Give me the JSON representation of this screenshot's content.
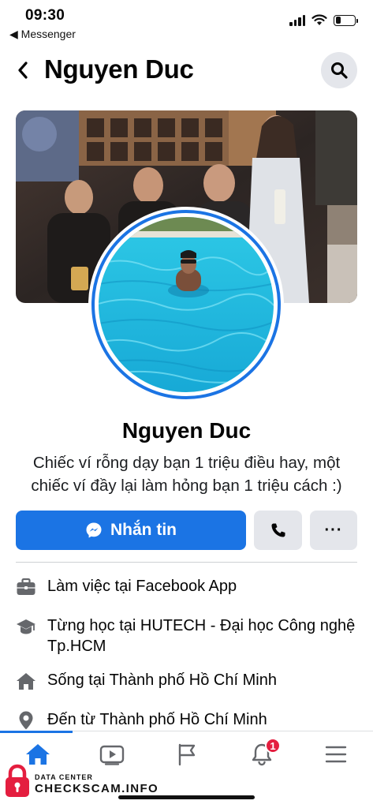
{
  "status_bar": {
    "time": "09:30",
    "back_label": "◀ Messenger",
    "battery_level": 0.3
  },
  "header": {
    "title": "Nguyen Duc"
  },
  "profile": {
    "name": "Nguyen Duc",
    "bio": "Chiếc ví rỗng dạy bạn 1 triệu điều hay, một chiếc ví đầy lại làm hỏng bạn 1 triệu cách :)"
  },
  "actions": {
    "message_label": "Nhắn tin",
    "more_label": "···"
  },
  "info": [
    {
      "icon": "briefcase-icon",
      "prefix": "Làm việc tại ",
      "value": "Facebook App"
    },
    {
      "icon": "graduation-cap-icon",
      "prefix": "Từng học tại ",
      "value": "HUTECH - Đại học Công nghệ Tp.HCM"
    },
    {
      "icon": "house-icon",
      "prefix": "Sống tại ",
      "value": "Thành phố Hồ Chí Minh"
    },
    {
      "icon": "location-pin-icon",
      "prefix": "Đến từ ",
      "value": "Thành phố Hồ Chí Minh"
    }
  ],
  "bottom_nav": {
    "tabs": [
      "home-icon",
      "video-icon",
      "flag-icon",
      "bell-icon",
      "menu-icon"
    ],
    "notification_count": "1",
    "active_tab": "home"
  },
  "watermark": {
    "small": "DATA CENTER",
    "big": "CHECKSCAM.INFO"
  },
  "colors": {
    "accent": "#1b74e4",
    "button_gray": "#e4e6eb",
    "badge_red": "#e41e3f"
  }
}
